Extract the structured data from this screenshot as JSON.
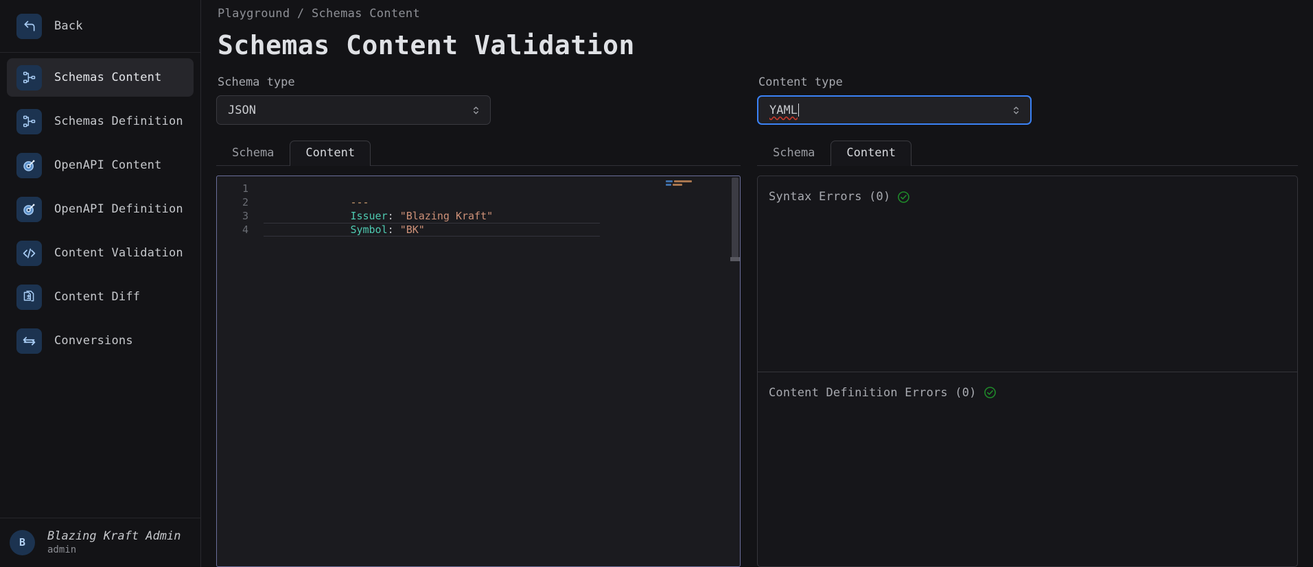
{
  "sidebar": {
    "back": {
      "label": "Back",
      "icon": "back-arrow-icon"
    },
    "items": [
      {
        "label": "Schemas Content",
        "icon": "schema-tree-icon",
        "active": true
      },
      {
        "label": "Schemas Definition",
        "icon": "schema-tree-icon",
        "active": false
      },
      {
        "label": "OpenAPI Content",
        "icon": "openapi-icon",
        "active": false
      },
      {
        "label": "OpenAPI Definition",
        "icon": "openapi-icon",
        "active": false
      },
      {
        "label": "Content Validation",
        "icon": "code-brackets-icon",
        "active": false
      },
      {
        "label": "Content Diff",
        "icon": "document-diff-icon",
        "active": false
      },
      {
        "label": "Conversions",
        "icon": "swap-arrows-icon",
        "active": false
      }
    ],
    "user": {
      "initial": "B",
      "name": "Blazing Kraft Admin",
      "role": "admin"
    }
  },
  "header": {
    "breadcrumb": "Playground / Schemas Content",
    "title": "Schemas Content Validation"
  },
  "left": {
    "select_label": "Schema type",
    "select_value": "JSON",
    "tabs": [
      {
        "label": "Schema",
        "active": false
      },
      {
        "label": "Content",
        "active": true
      }
    ],
    "editor": {
      "language": "yaml",
      "line_numbers": [
        "1",
        "2",
        "3",
        "4"
      ],
      "current_line": 4,
      "lines": [
        {
          "n": "1",
          "tokens": [
            {
              "t": "---",
              "c": "tok-punct"
            }
          ]
        },
        {
          "n": "2",
          "tokens": [
            {
              "t": "Issuer",
              "c": "tok-key"
            },
            {
              "t": ":",
              "c": "tok-colon"
            },
            {
              "t": " ",
              "c": "tok-colon"
            },
            {
              "t": "\"Blazing Kraft\"",
              "c": "tok-string"
            }
          ]
        },
        {
          "n": "3",
          "tokens": [
            {
              "t": "Symbol",
              "c": "tok-key"
            },
            {
              "t": ":",
              "c": "tok-colon"
            },
            {
              "t": " ",
              "c": "tok-colon"
            },
            {
              "t": "\"BK\"",
              "c": "tok-string"
            }
          ]
        },
        {
          "n": "4",
          "tokens": []
        }
      ]
    }
  },
  "right": {
    "select_label": "Content type",
    "select_value": "YAML",
    "select_focused": true,
    "tabs": [
      {
        "label": "Schema",
        "active": false
      },
      {
        "label": "Content",
        "active": true
      }
    ],
    "sections": [
      {
        "title": "Syntax Errors (0)",
        "status": "ok",
        "icon": "check-circle-icon"
      },
      {
        "title": "Content Definition Errors (0)",
        "status": "ok",
        "icon": "check-circle-icon"
      }
    ]
  },
  "colors": {
    "background": "#131316",
    "panel": "#16161a",
    "icon_tile": "#1c3350",
    "accent_focus": "#3b82f6",
    "success": "#1f8a2a",
    "editor_border": "#6b6f9c",
    "text_primary": "#dfe1e5",
    "text_muted": "#8e9096"
  }
}
